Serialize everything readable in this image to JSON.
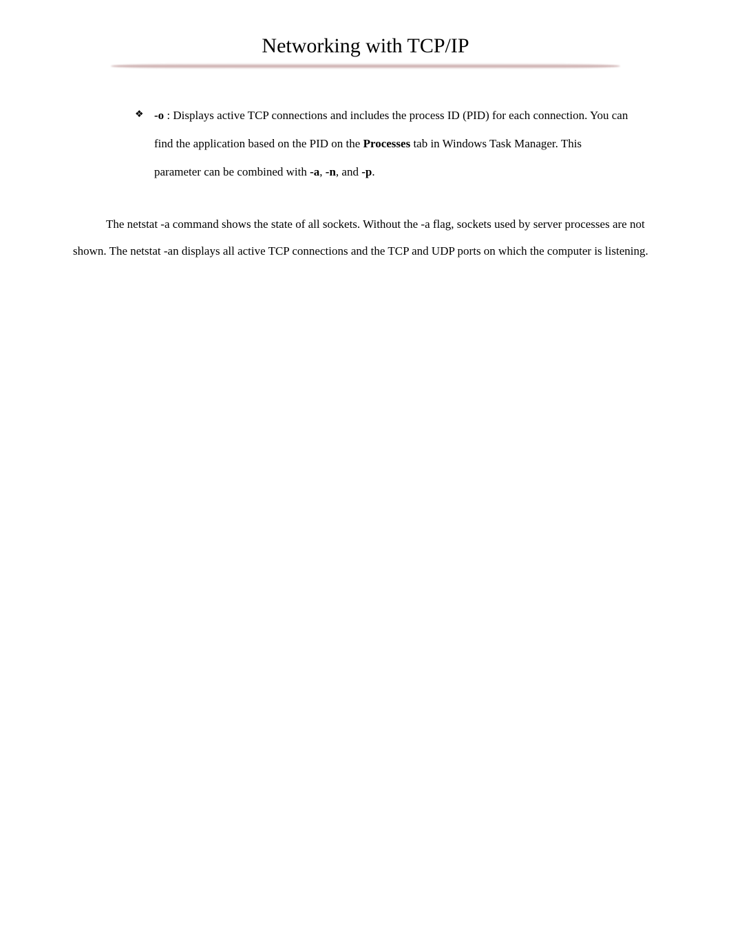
{
  "title": "Networking with TCP/IP",
  "bullet": {
    "marker": "❖",
    "flag": "-o",
    "sep": "   :",
    "text_1": " Displays active TCP connections and includes the process ID (PID) for each connection. You can find the application based on the PID on the ",
    "tab_name": "Processes",
    "text_2": " tab in Windows Task Manager. This parameter can be combined with ",
    "flag_a": "-a",
    "comma1": ", ",
    "flag_n": "-n",
    "comma2": ", and ",
    "flag_p": "-p",
    "period": "."
  },
  "paragraph": {
    "text": "The netstat -a command shows the state of all sockets. Without the -a flag, sockets used by server processes are not shown. The netstat -an displays all active TCP connections and the TCP and UDP ports on which the computer is listening."
  }
}
